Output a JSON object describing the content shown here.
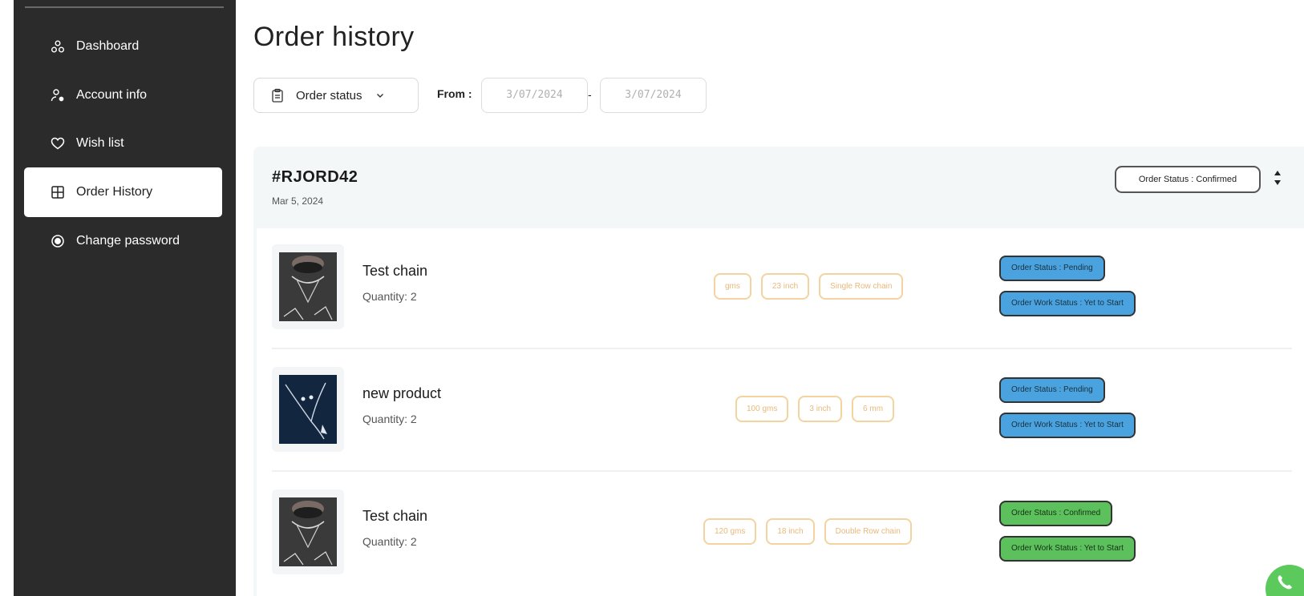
{
  "sidebar": {
    "items": [
      {
        "label": "Dashboard",
        "icon": "dashboard-icon",
        "active": false
      },
      {
        "label": "Account info",
        "icon": "user-settings-icon",
        "active": false
      },
      {
        "label": "Wish list",
        "icon": "heart-icon",
        "active": false
      },
      {
        "label": "Order History",
        "icon": "grid-icon",
        "active": true
      },
      {
        "label": "Change password",
        "icon": "password-reset-icon",
        "active": false
      }
    ]
  },
  "main": {
    "title": "Order history",
    "filters": {
      "order_status_label": "Order status",
      "from_label": "From :",
      "date_from": "3/07/2024",
      "date_separator": "-",
      "date_to": "3/07/2024"
    }
  },
  "order": {
    "id": "#RJORD42",
    "date": "Mar 5, 2024",
    "status": "Order Status : Confirmed",
    "items": [
      {
        "name": "Test chain",
        "quantity": "Quantity: 2",
        "tags": [
          "gms",
          "23 inch",
          "Single Row chain"
        ],
        "order_status": "Order Status : Pending",
        "work_status": "Order Work Status : Yet to Start"
      },
      {
        "name": "new product",
        "quantity": "Quantity: 2",
        "tags": [
          "100 gms",
          "3 inch",
          "6 mm"
        ],
        "order_status": "Order Status : Pending",
        "work_status": "Order Work Status : Yet to Start"
      },
      {
        "name": "Test chain",
        "quantity": "Quantity: 2",
        "tags": [
          "120 gms",
          "18 inch",
          "Double Row chain"
        ],
        "order_status": "Order Status : Confirmed",
        "work_status": "Order Work Status : Yet to Start"
      }
    ]
  },
  "colors": {
    "sidebar_bg": "#2b2b2b",
    "pending": "#4aa3de",
    "confirmed": "#5cc15c",
    "tag_border": "#f3d3a0",
    "whatsapp": "#5bc95b"
  }
}
